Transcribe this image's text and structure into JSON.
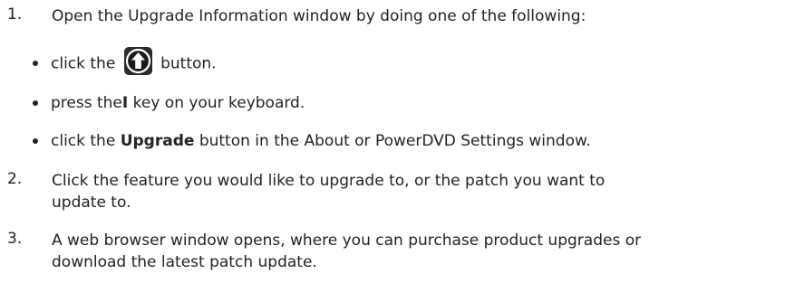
{
  "steps": [
    {
      "number": "1.",
      "text": "Open the Upgrade Information window by doing one of the following:",
      "bullets": [
        {
          "before": "click the",
          "icon": "upgrade-arrow-icon",
          "after": "button."
        },
        {
          "before": "press the",
          "key": "I",
          "after": "key on your keyboard."
        },
        {
          "before": "click the",
          "bold": "Upgrade",
          "after": "button in the About or PowerDVD Settings window."
        }
      ]
    },
    {
      "number": "2.",
      "line1": "Click the feature you would like to upgrade to, or the patch you want to",
      "line2": "update to."
    },
    {
      "number": "3.",
      "line1": "A web browser window opens, where you can purchase product upgrades or",
      "line2": "download the latest patch update."
    }
  ]
}
